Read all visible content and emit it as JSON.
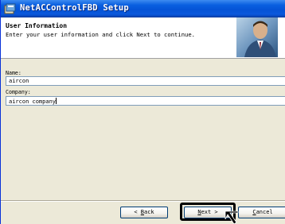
{
  "window": {
    "title": "NetACControlFBD Setup"
  },
  "header": {
    "title": "User Information",
    "subtitle": "Enter your user information and click Next to continue."
  },
  "form": {
    "name_label": "Name:",
    "name_value": "aircon",
    "company_label": "Company:",
    "company_value": "aircon company"
  },
  "buttons": {
    "back_prefix": "< ",
    "back_key": "B",
    "back_rest": "ack",
    "next_key": "N",
    "next_rest": "ext >",
    "cancel_key": "C",
    "cancel_rest": "ancel"
  },
  "colors": {
    "titlebar": "#0553d6",
    "dialog_bg": "#ece9d8",
    "input_border": "#7f9db9"
  },
  "icons": {
    "title": "installer-app-icon",
    "header": "person-photo",
    "pointer": "arrow-cursor-icon"
  }
}
